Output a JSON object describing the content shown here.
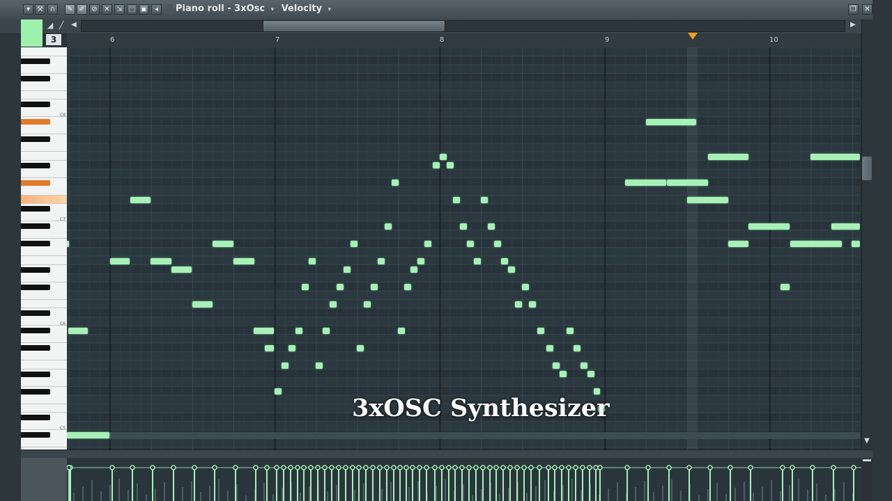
{
  "window": {
    "title": "Piano roll - 3xOsc",
    "mode_label": "Velocity",
    "dropdown_glyph": "▾"
  },
  "toolbar": {
    "tool_button_label": "3"
  },
  "ruler": {
    "bars": [
      "6",
      "7",
      "8",
      "9",
      "10"
    ]
  },
  "keyboard": {
    "octave_labels": [
      "C8",
      "C7",
      "C6",
      "C5"
    ]
  },
  "overlay": {
    "caption": "3xOSC Synthesizer"
  },
  "colors": {
    "note": "#a8f0b8",
    "grid": "#2c383f",
    "highlight_key": "#f7a35c",
    "playhead": "#f29a28"
  },
  "icons": [
    "menu-arrow-icon",
    "wrench-icon",
    "magnet-icon",
    "pencil-icon",
    "brush-icon",
    "delete-icon",
    "mute-icon",
    "slice-icon",
    "select-icon",
    "zoom-icon",
    "play-icon",
    "restore-icon",
    "close-icon"
  ]
}
